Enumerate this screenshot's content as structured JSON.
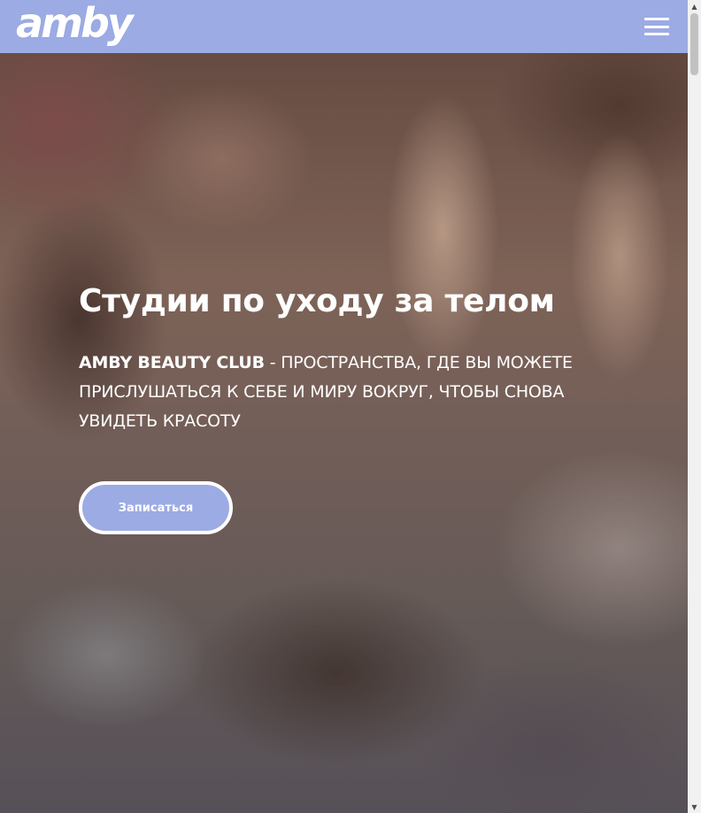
{
  "header": {
    "logo_text": "amby",
    "background_color": "#9cabe4",
    "menu_icon": "hamburger-menu-icon"
  },
  "hero": {
    "title": "Студии по уходу за телом",
    "subtitle_brand": "AMBY BEAUTY CLUB",
    "subtitle_text": " - ПРОСТРАНСТВА, ГДЕ ВЫ МОЖЕТЕ ПРИСЛУШАТЬСЯ К СЕБЕ И МИРУ ВОКРУГ, ЧТОБЫ СНОВА УВИДЕТЬ КРАСОТУ",
    "cta_label": "Записаться",
    "cta_color": "#9cabe4"
  },
  "scrollbar": {
    "up_arrow": "▲",
    "down_arrow": "▼"
  }
}
